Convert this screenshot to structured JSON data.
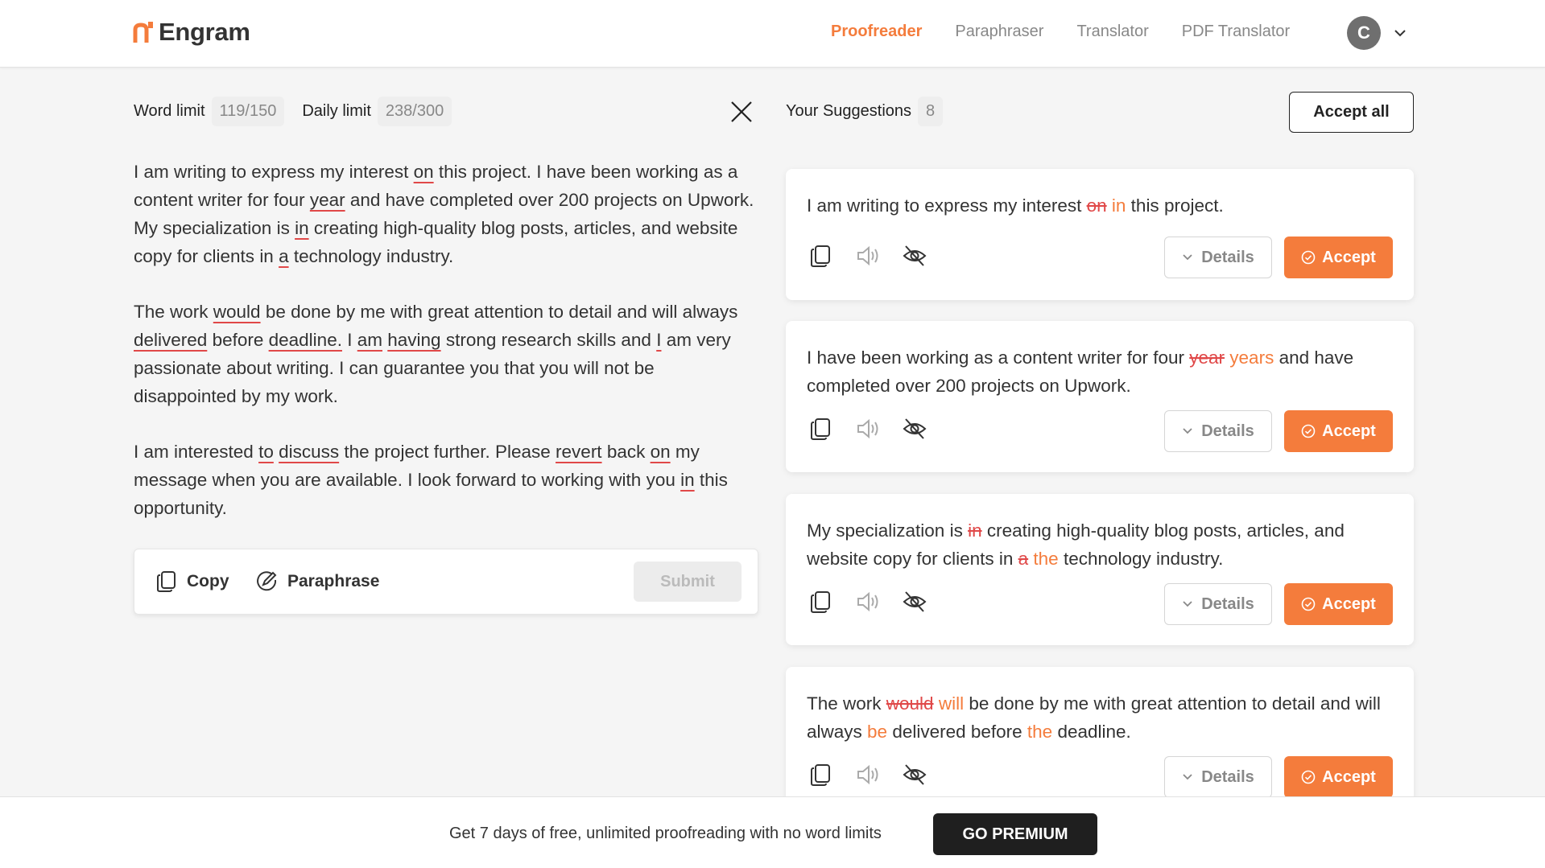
{
  "header": {
    "brand": "Engram",
    "nav": [
      "Proofreader",
      "Paraphraser",
      "Translator",
      "PDF Translator"
    ],
    "active_nav": "Proofreader",
    "avatar_initial": "C"
  },
  "limits": {
    "word_label": "Word limit",
    "word_value": "119/150",
    "daily_label": "Daily limit",
    "daily_value": "238/300"
  },
  "editor": {
    "paragraphs": [
      [
        {
          "t": "I am writing to express my interest "
        },
        {
          "t": "on",
          "u": true
        },
        {
          "t": " this project. I have been working as a content writer for four "
        },
        {
          "t": "year",
          "u": true
        },
        {
          "t": " and have completed over 200 projects on Upwork. My specialization is "
        },
        {
          "t": "in",
          "u": true
        },
        {
          "t": " creating high-quality blog posts, articles, and website copy for clients in "
        },
        {
          "t": "a",
          "u": true
        },
        {
          "t": " technology industry."
        }
      ],
      [
        {
          "t": "The work "
        },
        {
          "t": "would",
          "u": true
        },
        {
          "t": " be done by me with great attention to detail and will always "
        },
        {
          "t": "delivered",
          "u": true
        },
        {
          "t": " before "
        },
        {
          "t": "deadline.",
          "u": true
        },
        {
          "t": " I "
        },
        {
          "t": "am",
          "u": true
        },
        {
          "t": " "
        },
        {
          "t": "having",
          "u": true
        },
        {
          "t": " strong research skills and "
        },
        {
          "t": "I",
          "u": true
        },
        {
          "t": " am very passionate about writing. I can guarantee you that you will not be disappointed by my work."
        }
      ],
      [
        {
          "t": "I am interested "
        },
        {
          "t": "to",
          "u": true
        },
        {
          "t": " "
        },
        {
          "t": "discuss",
          "u": true
        },
        {
          "t": " the project further. Please "
        },
        {
          "t": "revert",
          "u": true
        },
        {
          "t": " back "
        },
        {
          "t": "on",
          "u": true
        },
        {
          "t": " my message when you are available. I look forward to working with you "
        },
        {
          "t": "in",
          "u": true
        },
        {
          "t": " this opportunity."
        }
      ]
    ]
  },
  "actions": {
    "copy_label": "Copy",
    "paraphrase_label": "Paraphrase",
    "submit_label": "Submit"
  },
  "suggestions": {
    "title": "Your Suggestions",
    "count": "8",
    "accept_all_label": "Accept all",
    "details_label": "Details",
    "accept_label": "Accept",
    "items": [
      [
        {
          "t": "I am writing to express my interest "
        },
        {
          "t": "on",
          "k": "del"
        },
        {
          "t": " "
        },
        {
          "t": "in",
          "k": "ins"
        },
        {
          "t": " this project."
        }
      ],
      [
        {
          "t": "I have been working as a content writer for four "
        },
        {
          "t": "year",
          "k": "del"
        },
        {
          "t": " "
        },
        {
          "t": "years",
          "k": "ins"
        },
        {
          "t": " and have completed over 200 projects on Upwork."
        }
      ],
      [
        {
          "t": "My specialization is "
        },
        {
          "t": "in",
          "k": "del"
        },
        {
          "t": " creating high-quality blog posts, articles, and website copy for clients in "
        },
        {
          "t": "a",
          "k": "del"
        },
        {
          "t": " "
        },
        {
          "t": "the",
          "k": "ins"
        },
        {
          "t": " technology industry."
        }
      ],
      [
        {
          "t": "The work "
        },
        {
          "t": "would",
          "k": "del"
        },
        {
          "t": " "
        },
        {
          "t": "will",
          "k": "ins"
        },
        {
          "t": " be done by me with great attention to detail and will always "
        },
        {
          "t": "be",
          "k": "ins"
        },
        {
          "t": " delivered before "
        },
        {
          "t": "the",
          "k": "ins"
        },
        {
          "t": " deadline."
        }
      ]
    ]
  },
  "promo": {
    "text": "Get 7 days of free, unlimited proofreading with no word limits",
    "button": "GO PREMIUM"
  },
  "colors": {
    "accent": "#f47c3c",
    "error": "#e04848",
    "dark": "#1f1f1f"
  },
  "icons": [
    "logo-icon",
    "chevron-down-icon",
    "close-icon",
    "copy-icon",
    "paraphrase-icon",
    "speaker-icon",
    "hide-icon",
    "check-circle-icon"
  ]
}
